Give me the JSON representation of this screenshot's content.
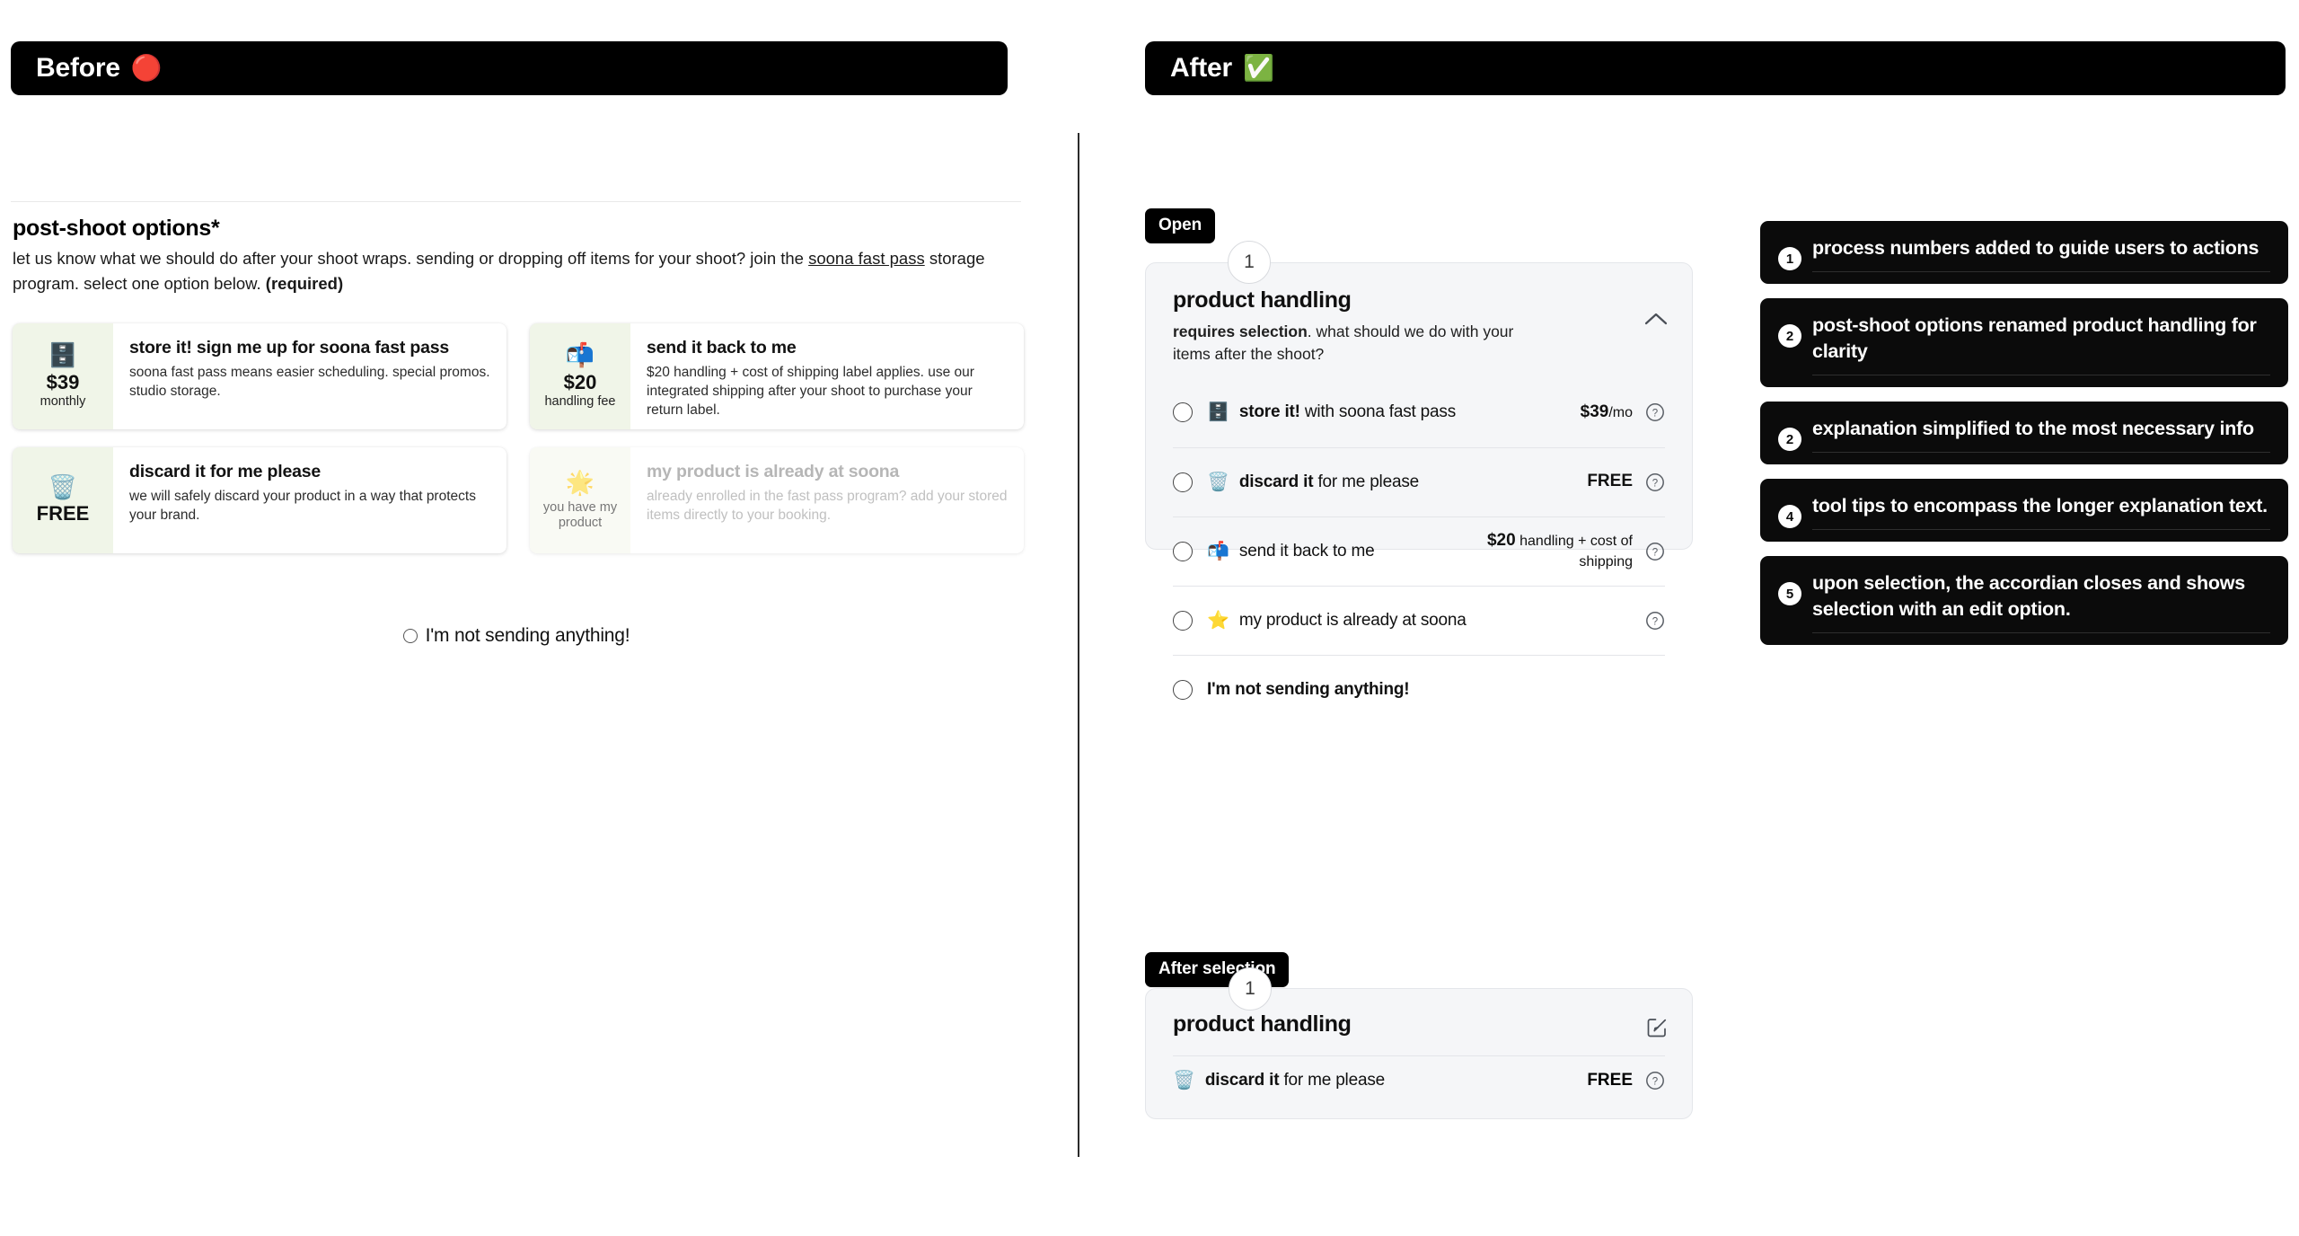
{
  "before": {
    "header_label": "Before",
    "header_emoji": "🔴",
    "title": "post-shoot options*",
    "description_part1": "let us know what we should do after your shoot wraps. sending or dropping off items for your shoot? join the ",
    "description_link": "soona fast pass",
    "description_part2": " storage program. select one option below. ",
    "description_required": "(required)",
    "options": [
      {
        "emoji": "🗄️",
        "price": "$39",
        "price_sub": "monthly",
        "title": "store it! sign me up for soona fast pass",
        "description": "soona fast pass means easier scheduling. special promos. studio storage.",
        "muted": false
      },
      {
        "emoji": "📬",
        "price": "$20",
        "price_sub": "handling fee",
        "title": "send it back to me",
        "description": "$20 handling + cost of shipping label applies. use our integrated shipping after your shoot to purchase your return label.",
        "muted": false
      },
      {
        "emoji": "🗑️",
        "price": "FREE",
        "price_sub": "",
        "title": "discard it for me please",
        "description": "we will safely discard your product in a way that protects your brand.",
        "muted": false
      },
      {
        "emoji": "🌟",
        "price": "",
        "price_sub": "you have my product",
        "title": "my product is already at soona",
        "description": "already enrolled in the fast pass program? add your stored items directly to your booking.",
        "muted": true
      }
    ],
    "not_sending_label": "I'm not sending anything!"
  },
  "after": {
    "header_label": "After",
    "header_emoji": "✅",
    "tag_open": "Open",
    "tag_after_selection": "After selection",
    "step_number_open": "1",
    "step_number_closed": "1",
    "accordion_open": {
      "title": "product handling",
      "subtitle_bold": "requires selection",
      "subtitle_rest": ". what should we do with your items after the shoot?",
      "collapse_icon": "chevron-up-icon",
      "rows": [
        {
          "emoji": "🗄️",
          "label_bold": "store it!",
          "label_rest": " with soona fast pass",
          "price_amount": "$39",
          "price_unit": "/mo",
          "price_two_line": false,
          "help": "?"
        },
        {
          "emoji": "🗑️",
          "label_bold": "discard it",
          "label_rest": " for me please",
          "price_amount": "FREE",
          "price_unit": "",
          "price_two_line": false,
          "help": "?"
        },
        {
          "emoji": "📬",
          "label_bold": "",
          "label_rest": "send it back to me",
          "price_amount": "$20",
          "price_unit": " handling + cost of shipping",
          "price_two_line": true,
          "help": "?"
        },
        {
          "emoji": "⭐",
          "label_bold": "",
          "label_rest": "my product is already at soona",
          "price_amount": "",
          "price_unit": "",
          "price_two_line": false,
          "help": "?"
        },
        {
          "emoji": "",
          "label_bold": "I'm not sending anything!",
          "label_rest": "",
          "price_amount": "",
          "price_unit": "",
          "price_two_line": false,
          "help": ""
        }
      ]
    },
    "accordion_closed": {
      "title": "product handling",
      "edit_icon": "edit-pencil-icon",
      "selected": {
        "emoji": "🗑️",
        "label_bold": "discard it",
        "label_rest": " for me please",
        "price": "FREE",
        "help": "?"
      }
    }
  },
  "annotations": [
    {
      "number": "1",
      "text": "process numbers added to guide users to actions"
    },
    {
      "number": "2",
      "text": "post-shoot options renamed product handling for clarity"
    },
    {
      "number": "2",
      "text": "explanation simplified to the most necessary info"
    },
    {
      "number": "4",
      "text": "tool tips to encompass the longer explanation text."
    },
    {
      "number": "5",
      "text": "upon selection, the accordian closes and shows selection with an edit option."
    }
  ],
  "colors": {
    "black": "#000000",
    "card_bg": "#f5f6f8",
    "badge_green": "#f0f5e8",
    "divider": "#e3e5e9"
  }
}
